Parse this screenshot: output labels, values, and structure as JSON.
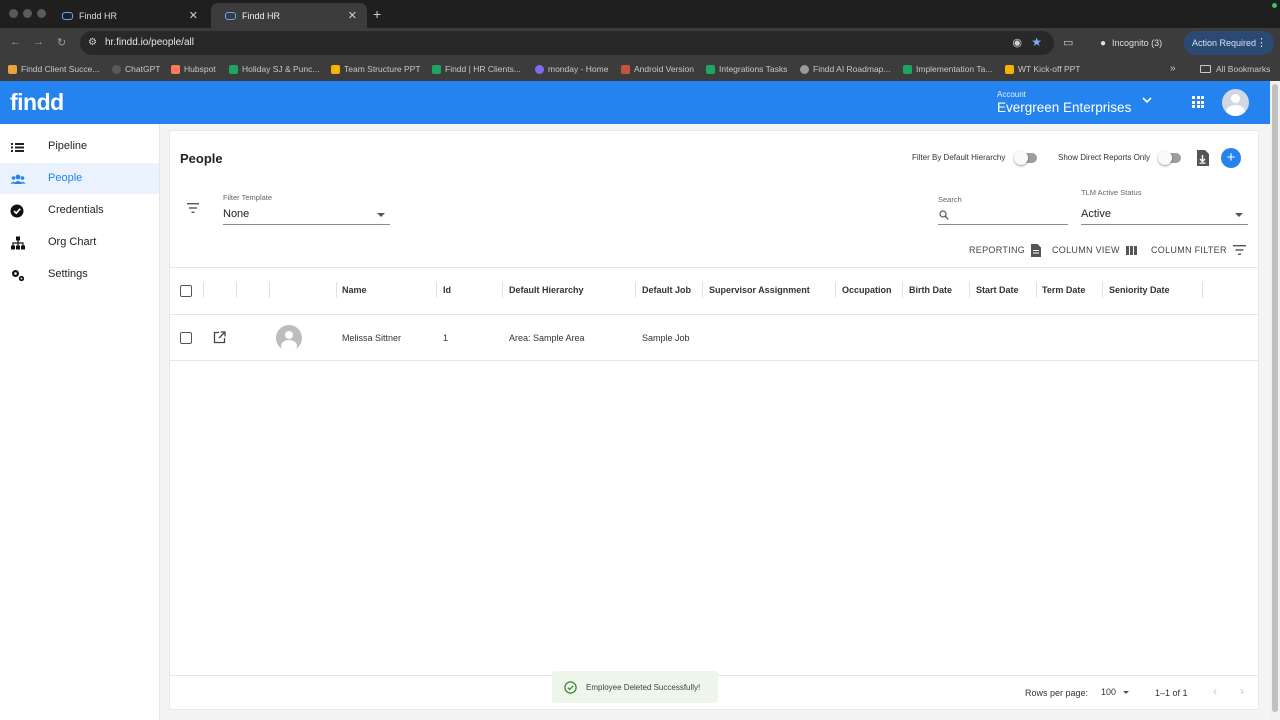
{
  "browser": {
    "tabs": [
      {
        "title": "Findd HR",
        "active": false
      },
      {
        "title": "Findd HR",
        "active": true
      }
    ],
    "url": "hr.findd.io/people/all",
    "incognito_label": "Incognito (3)",
    "action_required_label": "Action Required",
    "bookmarks": [
      {
        "label": "Findd Client Succe...",
        "color": "#e8a33b"
      },
      {
        "label": "ChatGPT",
        "color": "#5a5a5a"
      },
      {
        "label": "Hubspot",
        "color": "#ff7a59"
      },
      {
        "label": "Holiday SJ & Punc...",
        "color": "#1fa463"
      },
      {
        "label": "Team Structure PPT",
        "color": "#f4b400"
      },
      {
        "label": "Findd | HR Clients...",
        "color": "#1fa463"
      },
      {
        "label": "monday - Home",
        "color": "#7c6cf0"
      },
      {
        "label": "Android Version",
        "color": "#c2543e"
      },
      {
        "label": "Integrations Tasks",
        "color": "#1fa463"
      },
      {
        "label": "Findd AI Roadmap...",
        "color": "#9a9a9a"
      },
      {
        "label": "Implementation Ta...",
        "color": "#1fa463"
      },
      {
        "label": "WT Kick-off PPT",
        "color": "#f4b400"
      }
    ],
    "bookmarks_more": "»",
    "all_bookmarks_label": "All Bookmarks"
  },
  "header": {
    "logo": "findd",
    "account_label": "Account",
    "account_name": "Evergreen Enterprises"
  },
  "sidebar": {
    "items": [
      {
        "label": "Pipeline",
        "icon": "list-icon",
        "active": false
      },
      {
        "label": "People",
        "icon": "people-icon",
        "active": true
      },
      {
        "label": "Credentials",
        "icon": "check-circle-icon",
        "active": false
      },
      {
        "label": "Org Chart",
        "icon": "org-chart-icon",
        "active": false
      },
      {
        "label": "Settings",
        "icon": "gears-icon",
        "active": false
      }
    ]
  },
  "page": {
    "title": "People",
    "toggles": {
      "default_hierarchy_label": "Filter By Default Hierarchy",
      "direct_reports_label": "Show Direct Reports Only"
    },
    "filter_template": {
      "label": "Filter Template",
      "value": "None"
    },
    "search": {
      "label": "Search",
      "value": ""
    },
    "tlm_status": {
      "label": "TLM Active Status",
      "value": "Active"
    },
    "toolbar": {
      "reporting": "REPORTING",
      "column_view": "COLUMN VIEW",
      "column_filter": "COLUMN FILTER"
    }
  },
  "table": {
    "columns": [
      "Name",
      "Id",
      "Default Hierarchy",
      "Default Job",
      "Supervisor Assignment",
      "Occupation",
      "Birth Date",
      "Start Date",
      "Term Date",
      "Seniority Date"
    ],
    "rows": [
      {
        "name": "Melissa Sittner",
        "id": "1",
        "default_hierarchy": "Area: Sample Area",
        "default_job": "Sample Job"
      }
    ]
  },
  "pagination": {
    "rows_per_page_label": "Rows per page:",
    "rows_per_page": "100",
    "range": "1–1 of 1"
  },
  "snackbar": {
    "message": "Employee Deleted Successfully!"
  },
  "colors": {
    "brand": "#2583ef",
    "success_bg": "#eef5ea"
  }
}
